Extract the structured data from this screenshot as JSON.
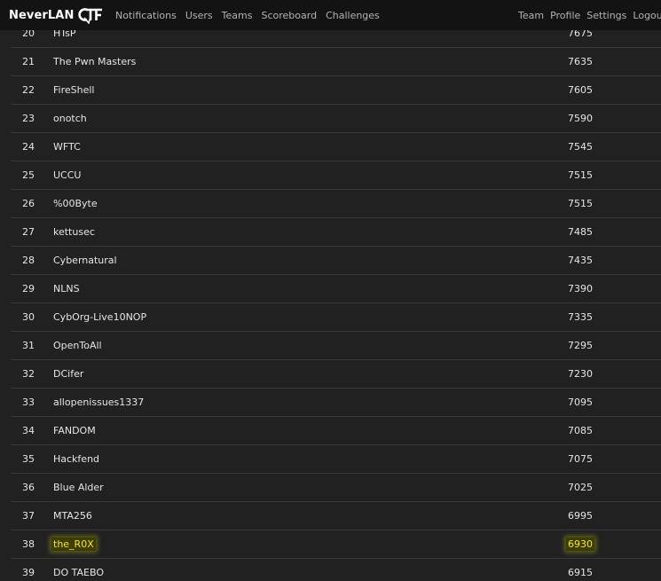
{
  "navbar": {
    "brand": "NeverLAN",
    "left_links": [
      "Notifications",
      "Users",
      "Teams",
      "Scoreboard",
      "Challenges"
    ],
    "right_links": [
      "Team",
      "Profile",
      "Settings",
      "Logout"
    ]
  },
  "scoreboard": {
    "highlighted_team": "the_R0X",
    "highlight_color": "#f4e43a",
    "rows": [
      {
        "place": "20",
        "team": "HTsP",
        "score": "7675"
      },
      {
        "place": "21",
        "team": "The Pwn Masters",
        "score": "7635"
      },
      {
        "place": "22",
        "team": "FireShell",
        "score": "7605"
      },
      {
        "place": "23",
        "team": "onotch",
        "score": "7590"
      },
      {
        "place": "24",
        "team": "WFTC",
        "score": "7545"
      },
      {
        "place": "25",
        "team": "UCCU",
        "score": "7515"
      },
      {
        "place": "26",
        "team": "%00Byte",
        "score": "7515"
      },
      {
        "place": "27",
        "team": "kettusec",
        "score": "7485"
      },
      {
        "place": "28",
        "team": "Cybernatural",
        "score": "7435"
      },
      {
        "place": "29",
        "team": "NLNS",
        "score": "7390"
      },
      {
        "place": "30",
        "team": "CybOrg-Live10NOP",
        "score": "7335"
      },
      {
        "place": "31",
        "team": "OpenToAll",
        "score": "7295"
      },
      {
        "place": "32",
        "team": "DCifer",
        "score": "7230"
      },
      {
        "place": "33",
        "team": "allopenissues1337",
        "score": "7095"
      },
      {
        "place": "34",
        "team": "FANDOM",
        "score": "7085"
      },
      {
        "place": "35",
        "team": "Hackfend",
        "score": "7075"
      },
      {
        "place": "36",
        "team": "Blue Alder",
        "score": "7025"
      },
      {
        "place": "37",
        "team": "MTA256",
        "score": "6995"
      },
      {
        "place": "38",
        "team": "the_R0X",
        "score": "6930",
        "highlighted": true
      },
      {
        "place": "39",
        "team": "DO TAEBO",
        "score": "6915"
      }
    ]
  }
}
